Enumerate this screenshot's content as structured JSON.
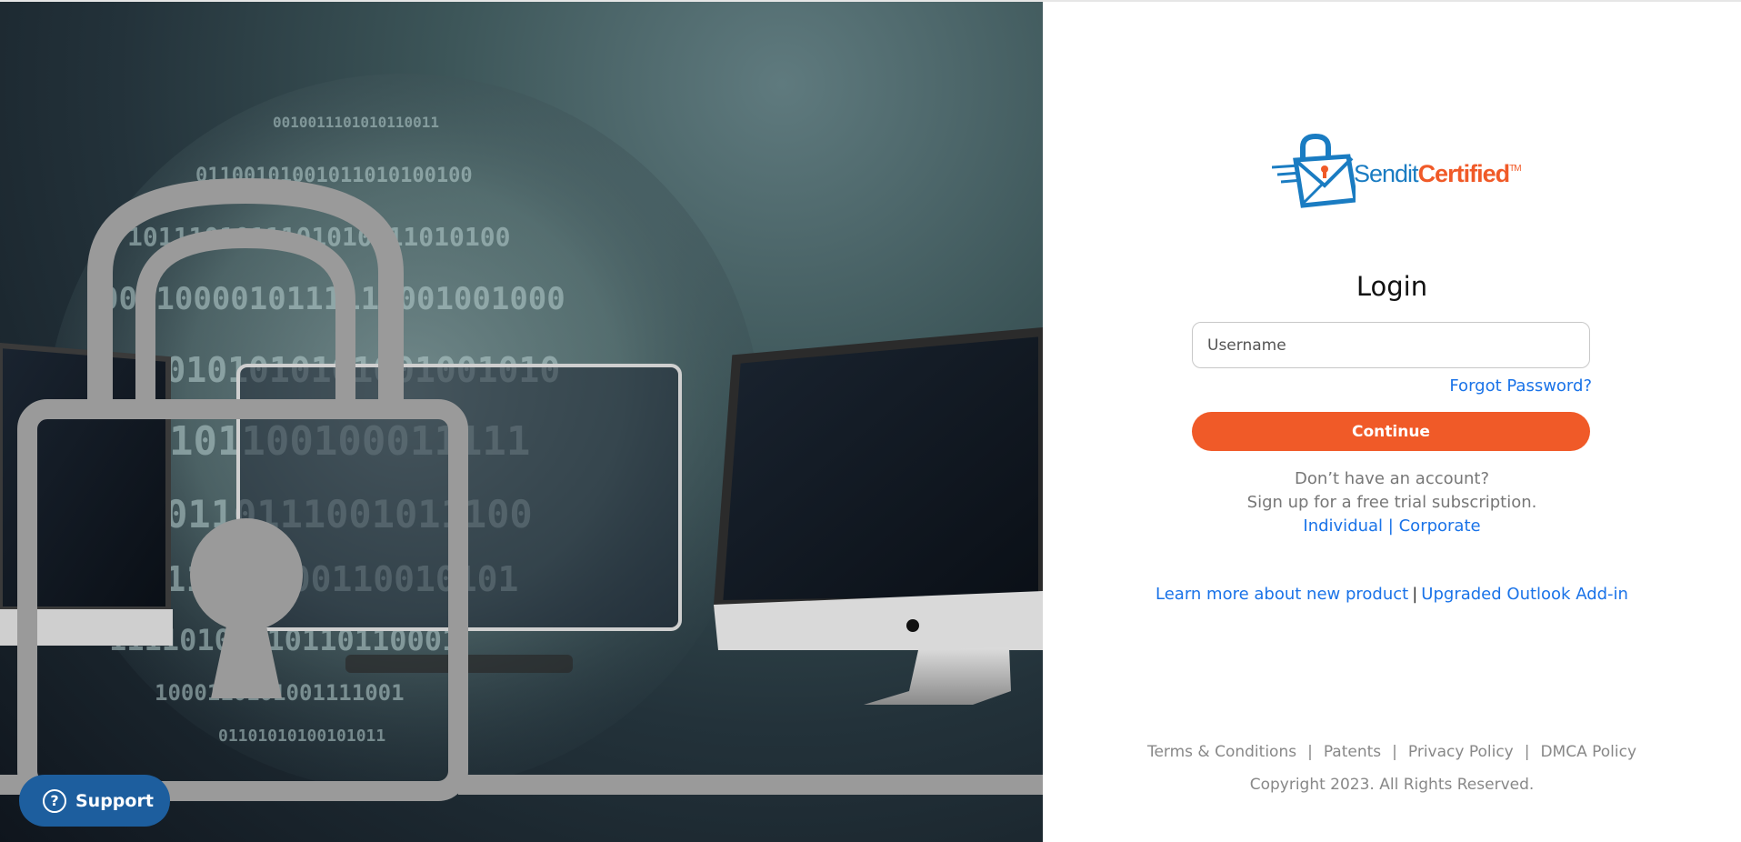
{
  "hero": {
    "image_icon": "padlock-monitors-binary-globe-illustration"
  },
  "support": {
    "label": "Support",
    "icon": "?",
    "icon_name": "question-circle-icon",
    "color": "#1d5e9e"
  },
  "logo": {
    "text_light": "Sendit",
    "text_bold": "Certified",
    "tm": "TM",
    "icon_name": "padlock-envelope-logo-icon"
  },
  "login": {
    "title": "Login",
    "username_placeholder": "Username",
    "forgot_password": "Forgot Password?",
    "continue_label": "Continue"
  },
  "signup": {
    "line1": "Don’t have an account?",
    "line2": "Sign up for a free trial subscription.",
    "individual": "Individual",
    "separator": "|",
    "corporate": "Corporate"
  },
  "learn": {
    "new_product": "Learn more about new product",
    "separator": "|",
    "outlook": "Upgraded Outlook Add-in"
  },
  "footer": {
    "terms": "Terms & Conditions",
    "patents": "Patents",
    "privacy": "Privacy Policy",
    "dmca": "DMCA Policy",
    "separator": "|",
    "copyright": "Copyright 2023. All Rights Reserved."
  },
  "colors": {
    "accent": "#f05a28",
    "link": "#1a73e8",
    "brand_blue": "#1a7cc2"
  }
}
